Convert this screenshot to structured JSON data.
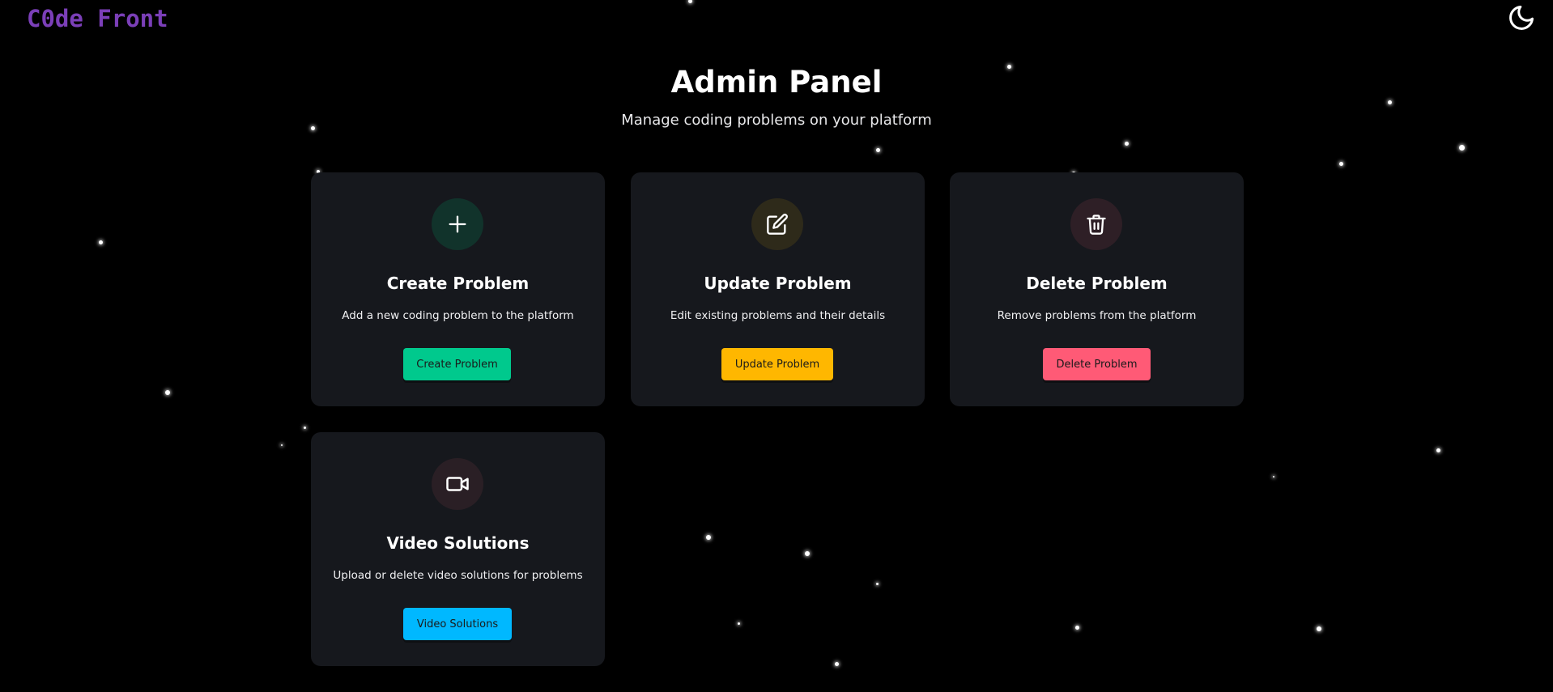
{
  "brand": {
    "name": "C0de Front"
  },
  "header": {
    "title": "Admin Panel",
    "subtitle": "Manage coding problems on your platform"
  },
  "theme_toggle": {
    "icon": "moon-icon"
  },
  "cards": [
    {
      "title": "Create Problem",
      "description": "Add a new coding problem to the platform",
      "button_label": "Create Problem",
      "icon": "plus-icon",
      "accent": "#00c98d",
      "icon_bg": "#11332b"
    },
    {
      "title": "Update Problem",
      "description": "Edit existing problems and their details",
      "button_label": "Update Problem",
      "icon": "edit-icon",
      "accent": "#ffb700",
      "icon_bg": "#2e2a1a"
    },
    {
      "title": "Delete Problem",
      "description": "Remove problems from the platform",
      "button_label": "Delete Problem",
      "icon": "trash-icon",
      "accent": "#ff5a76",
      "icon_bg": "#2e1f26"
    },
    {
      "title": "Video Solutions",
      "description": "Upload or delete video solutions for problems",
      "button_label": "Video Solutions",
      "icon": "video-icon",
      "accent": "#00b8ff",
      "icon_bg": "#2a1f25"
    }
  ],
  "colors": {
    "background": "#000000",
    "card": "#16181d",
    "brand": "#7b3fb8"
  }
}
